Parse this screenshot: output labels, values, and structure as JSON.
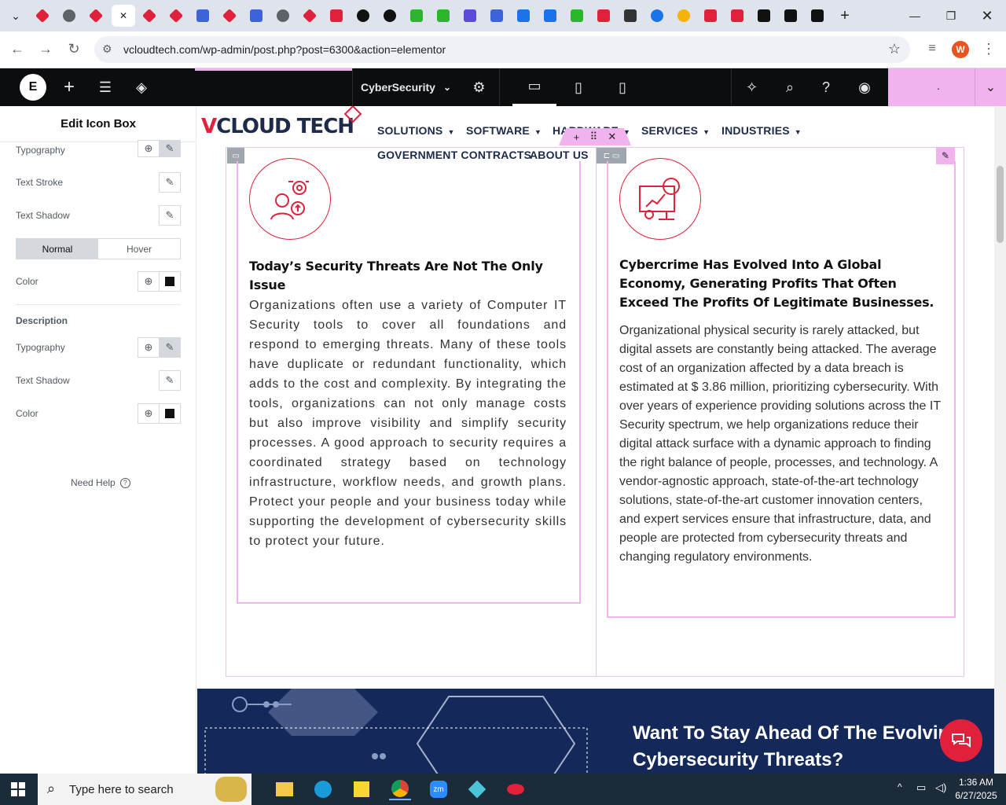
{
  "browser": {
    "tabs": [
      {
        "icon": "red-diamond-icon",
        "color": "#e0213b"
      },
      {
        "icon": "globe-icon",
        "color": "#5f6368"
      },
      {
        "icon": "red-diamond-icon",
        "color": "#e0213b"
      },
      {
        "icon": "close-icon",
        "color": "#222",
        "active": true
      },
      {
        "icon": "red-diamond-icon",
        "color": "#e0213b"
      },
      {
        "icon": "red-diamond-icon",
        "color": "#e0213b"
      },
      {
        "icon": "wp-check-icon",
        "color": "#3c64d8"
      },
      {
        "icon": "red-diamond-icon",
        "color": "#e0213b"
      },
      {
        "icon": "network-icon",
        "color": "#3c64d8"
      },
      {
        "icon": "globe-icon",
        "color": "#5f6368"
      },
      {
        "icon": "red-diamond-icon",
        "color": "#e0213b"
      },
      {
        "icon": "youtube-icon",
        "color": "#e0213b"
      },
      {
        "icon": "openai-icon",
        "color": "#111"
      },
      {
        "icon": "openai-icon",
        "color": "#111"
      },
      {
        "icon": "bolt-icon",
        "color": "#2db52d"
      },
      {
        "icon": "bolt-icon",
        "color": "#2db52d"
      },
      {
        "icon": "shield-icon",
        "color": "#5b4bd8"
      },
      {
        "icon": "network-icon",
        "color": "#3c64d8"
      },
      {
        "icon": "grid-icon",
        "color": "#1a73e8"
      },
      {
        "icon": "grid-icon",
        "color": "#1a73e8"
      },
      {
        "icon": "bolt-icon",
        "color": "#2db52d"
      },
      {
        "icon": "youtube-icon",
        "color": "#e0213b"
      },
      {
        "icon": "lock-icon",
        "color": "#333"
      },
      {
        "icon": "edge-arc-icon",
        "color": "#1a73e8"
      },
      {
        "icon": "rainbow-circle-icon",
        "color": "#f4b400"
      },
      {
        "icon": "youtube-icon",
        "color": "#e0213b"
      },
      {
        "icon": "youtube-icon",
        "color": "#e0213b"
      },
      {
        "icon": "x-logo-icon",
        "color": "#111"
      },
      {
        "icon": "x-logo-icon",
        "color": "#111"
      },
      {
        "icon": "h-logo-icon",
        "color": "#111"
      }
    ],
    "new_tab_label": "+",
    "url": "vcloudtech.com/wp-admin/post.php?post=6300&action=elementor",
    "profile_initial": "W"
  },
  "elementor": {
    "page_name": "CyberSecurity",
    "panel_title": "Edit Icon Box",
    "rows": {
      "typography1": "Typography",
      "text_stroke": "Text Stroke",
      "text_shadow1": "Text Shadow",
      "color1": "Color",
      "section_description": "Description",
      "typography2": "Typography",
      "text_shadow2": "Text Shadow",
      "color2": "Color"
    },
    "state_tabs": {
      "normal": "Normal",
      "hover": "Hover"
    },
    "need_help": "Need Help",
    "publish_label": "."
  },
  "site": {
    "logo_text": "CLOUD TECH",
    "logo_v": "V",
    "menu": [
      "SOLUTIONS",
      "SOFTWARE",
      "HARDWARE",
      "SERVICES",
      "INDUSTRIES"
    ],
    "menu2": [
      "GOVERNMENT CONTRACTS",
      "ABOUT US"
    ],
    "col1": {
      "heading": "Today’s Security Threats Are Not The Only Issue",
      "body": "Organizations often use a variety of Computer IT Security tools to cover all foundations and respond to emerging threats. Many of these tools have duplicate or redundant functionality, which adds to the cost and complexity. By integrating the tools, organizations can not only manage costs but also improve visibility and simplify security processes. A good approach to security requires a coordinated strategy based on technology infrastructure, workflow needs, and growth plans. Protect your people and your business today while supporting the development of cybersecurity skills to protect your future."
    },
    "col2": {
      "heading": "Cybercrime Has Evolved Into A Global Economy, Generating Profits That Often Exceed The Profits Of Legitimate Businesses.",
      "body": "Organizational physical security is rarely attacked, but digital assets are constantly being attacked. The average cost of an organization affected by a data breach is estimated at $ 3.86 million, prioritizing cybersecurity. With over years of experience providing solutions across the IT Security spectrum, we help organizations reduce their digital attack surface with a dynamic approach to finding the right balance of people, processes, and technology. A vendor-agnostic approach, state-of-the-art technology solutions, state-of-the-art customer innovation centers, and expert services ensure that infrastructure, data, and people are protected from cybersecurity threats and changing regulatory environments."
    },
    "banner_title_line1": "Want To Stay Ahead Of The Evolvir",
    "banner_title_line2": "Cybersecurity Threats?"
  },
  "taskbar": {
    "search_placeholder": "Type here to search",
    "time": "1:36 AM",
    "date": "6/27/2025"
  },
  "colors": {
    "accent": "#e0213b",
    "elementor_pink": "#f0b3ee",
    "navy": "#1e2a4a"
  }
}
